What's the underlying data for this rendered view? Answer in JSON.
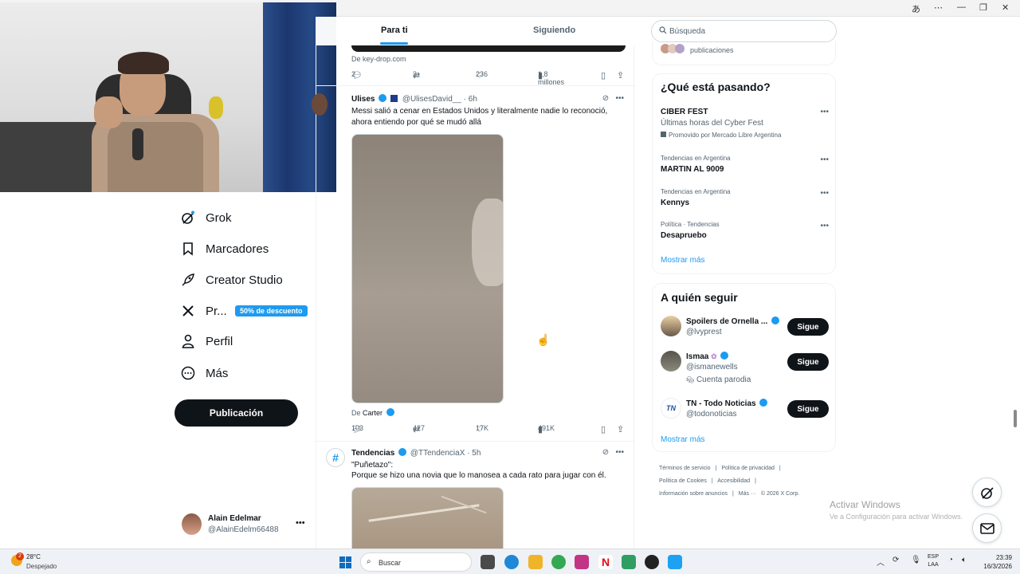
{
  "nav": {
    "items": [
      {
        "label": "Grok"
      },
      {
        "label": "Marcadores"
      },
      {
        "label": "Creator Studio"
      },
      {
        "label": "Pr..."
      },
      {
        "label": "Perfil"
      },
      {
        "label": "Más"
      }
    ],
    "premium_badge": "50% de descuento",
    "post_button": "Publicación",
    "account_name": "Alain Edelmar",
    "account_handle": "@AlainEdelm66488",
    "account_more": "•••"
  },
  "feed": {
    "tabs": [
      "Para ti",
      "Siguiendo"
    ],
    "tweet0": {
      "source": "De key-drop.com",
      "replies": "2",
      "retweets": "3",
      "likes": "236",
      "views": "1,8 millones"
    },
    "tweet1": {
      "name": "Ulises",
      "handle": "@UlisesDavid__",
      "time": "· 6h",
      "text": "Messi salió a cenar en Estados Unidos y literalmente nadie lo reconoció, ahora entiendo por qué se mudó allá",
      "source_prefix": "De",
      "source_name": "Carter",
      "replies": "103",
      "retweets": "427",
      "likes": "17K",
      "views": "491K"
    },
    "tweet2": {
      "name": "Tendencias",
      "handle": "@TTendenciaX",
      "time": "· 5h",
      "text_line1": "\"Puñetazo\":",
      "text_line2": "Porque se hizo una novia que lo manosea a cada rato para jugar con él."
    }
  },
  "right": {
    "search_placeholder": "Búsqueda",
    "top_card_text": "publicaciones",
    "trends_title": "¿Qué está pasando?",
    "trends": [
      {
        "category": "",
        "name": "CIBER FEST",
        "sub": "Últimas horas del Cyber Fest",
        "promo": "Promovido por Mercado Libre Argentina"
      },
      {
        "category": "Tendencias en Argentina",
        "name": "MARTIN AL 9009"
      },
      {
        "category": "Tendencias en Argentina",
        "name": "Kennys"
      },
      {
        "category": "Política · Tendencias",
        "name": "Desapruebo"
      }
    ],
    "show_more": "Mostrar más",
    "follow_title": "A quién seguir",
    "follow": [
      {
        "name": "Spoilers de Ornella ...",
        "handle": "@lvyprest",
        "extra": "",
        "button": "Sigue"
      },
      {
        "name": "Ismaa",
        "handle": "@ismanewells",
        "extra": "Cuenta parodia",
        "button": "Sigue"
      },
      {
        "name": "TN - Todo Noticias",
        "handle": "@todonoticias",
        "extra": "",
        "button": "Sigue"
      }
    ],
    "follow_more": "Mostrar más",
    "footer": [
      "Términos de servicio",
      "|",
      "Política de privacidad",
      "|",
      "Política de Cookies",
      "|",
      "Accesibilidad",
      "|",
      "Información sobre anuncios",
      "|",
      "Más ···",
      "© 2026 X Corp."
    ]
  },
  "windows": {
    "activate_title": "Activar Windows",
    "activate_sub": "Ve a Configuración para activar Windows."
  },
  "taskbar": {
    "temperature": "28°C",
    "weather": "Despejado",
    "weather_badge": "2",
    "search": "Buscar",
    "lang_line1": "ESP",
    "lang_line2": "LAA",
    "time": "23:39",
    "date": "16/3/2026"
  }
}
